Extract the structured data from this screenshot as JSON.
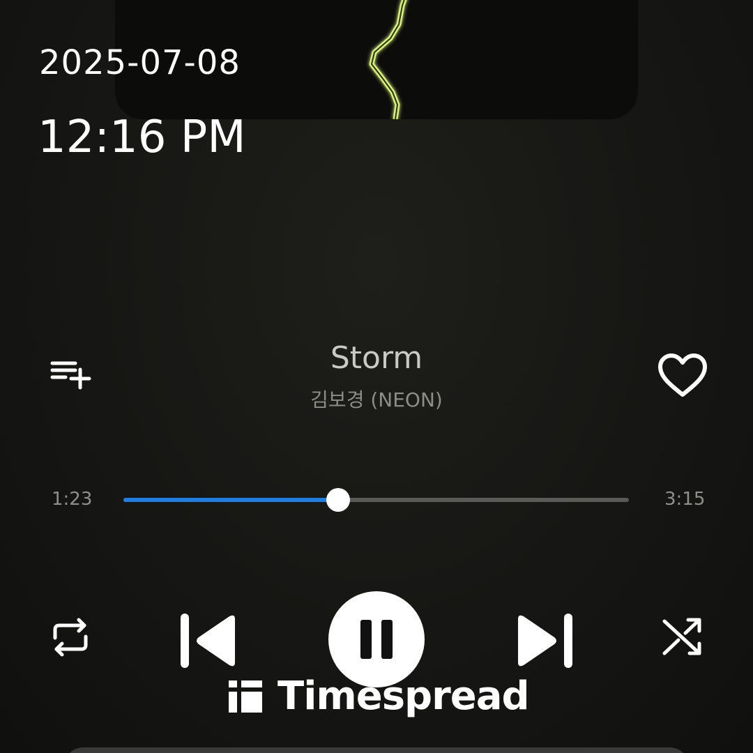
{
  "lockscreen": {
    "date": "2025-07-08",
    "time": "12:16 PM"
  },
  "player": {
    "title": "Storm",
    "artist": "김보경 (NEON)",
    "elapsed": "1:23",
    "duration": "3:15",
    "progress_fraction": 0.425,
    "is_playing": true,
    "accent_color": "#1f7fe0",
    "controls": {
      "add_to_playlist_icon": "playlist-add-icon",
      "favorite_icon": "heart-outline-icon",
      "repeat_icon": "repeat-icon",
      "previous_icon": "skip-previous-icon",
      "play_pause_icon": "pause-icon",
      "next_icon": "skip-next-icon",
      "shuffle_icon": "shuffle-icon"
    }
  },
  "watermark": {
    "text": "Timespread",
    "logo_icon": "timespread-logo-icon"
  }
}
